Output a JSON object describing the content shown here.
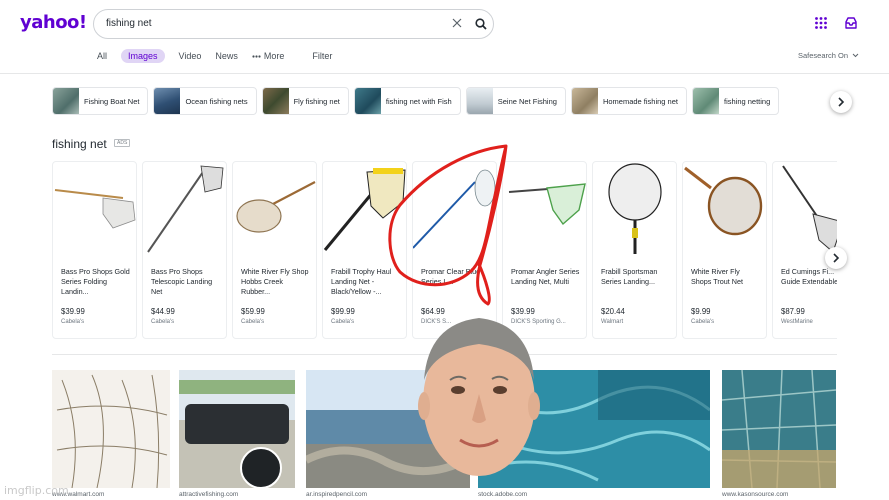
{
  "header": {
    "logo": "yahoo!",
    "search_value": "fishing net"
  },
  "tabs": [
    {
      "label": "All"
    },
    {
      "label": "Images",
      "active": true
    },
    {
      "label": "Video"
    },
    {
      "label": "News"
    },
    {
      "label": "More"
    }
  ],
  "filter_label": "Filter",
  "safesearch_label": "Safesearch On",
  "chips": [
    {
      "label": "Fishing Boat Net"
    },
    {
      "label": "Ocean fishing nets"
    },
    {
      "label": "Fly fishing net"
    },
    {
      "label": "fishing net with Fish"
    },
    {
      "label": "Seine Net Fishing"
    },
    {
      "label": "Homemade fishing net"
    },
    {
      "label": "fishing netting"
    }
  ],
  "shopping": {
    "title": "fishing net",
    "ads_label": "ADS",
    "products": [
      {
        "name": "Bass Pro Shops Gold Series Folding Landin...",
        "price": "$39.99",
        "store": "Cabela's"
      },
      {
        "name": "Bass Pro Shops Telescopic Landing Net",
        "price": "$44.99",
        "store": "Cabela's"
      },
      {
        "name": "White River Fly Shop Hobbs Creek Rubber...",
        "price": "$59.99",
        "store": "Cabela's"
      },
      {
        "name": "Frabill Trophy Haul Landing Net - Black/Yellow -...",
        "price": "$99.99",
        "store": "Cabela's"
      },
      {
        "name": "Promar Clear Blue Series L...",
        "price": "$64.99",
        "store": "DICK'S S..."
      },
      {
        "name": "Promar Angler Series Landing Net, Multi",
        "price": "$39.99",
        "store": "DICK'S Sporting G..."
      },
      {
        "name": "Frabill Sportsman Series Landing...",
        "price": "$20.44",
        "store": "Walmart"
      },
      {
        "name": "White River Fly Shops Trout Net",
        "price": "$9.99",
        "store": "Cabela's"
      },
      {
        "name": "Ed Cumings Fi... Guide Extendable...",
        "price": "$87.99",
        "store": "WestMarine"
      }
    ]
  },
  "results": [
    {
      "source": "www.walmart.com"
    },
    {
      "source": "attractivefishing.com"
    },
    {
      "source": "ar.inspiredpencil.com"
    },
    {
      "source": "stock.adobe.com"
    },
    {
      "source": "www.kasonsource.com"
    }
  ],
  "watermark": "imgflip.com",
  "colors": {
    "brand": "#6001d2",
    "scribble": "#e0201c",
    "tab_active_bg": "#e0d5f5"
  }
}
